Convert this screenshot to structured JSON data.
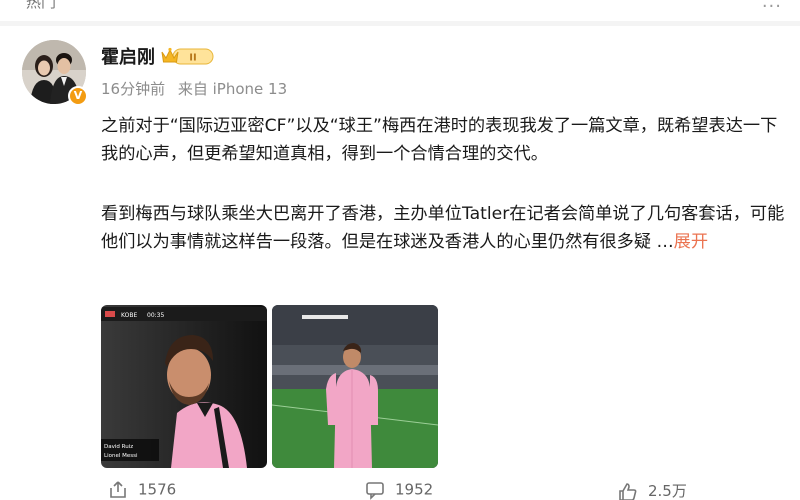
{
  "header": {
    "tab_label": "热门",
    "more_menu": "···"
  },
  "post": {
    "author": {
      "name": "霍启刚",
      "badge_level": "II",
      "verified_mark": "V"
    },
    "meta": {
      "time": "16分钟前",
      "source": "来自 iPhone 13"
    },
    "paragraphs": [
      "之前对于“国际迈亚密CF”以及“球王”梅西在港时的表现我发了一篇文章，既希望表达一下我的心声，但更希望知道真相，得到一个合情合理的交代。",
      "看到梅西与球队乘坐大巴离开了香港，主办单位Tatler在记者会简单说了几句客套话，可能他们以为事情就这样告一段落。但是在球迷及香港人的心里仍然有很多疑 …"
    ],
    "expand_label": "展开",
    "images": [
      {
        "overlay_team": "KOBE",
        "overlay_score": "00:35",
        "caption_line1": "David Ruiz",
        "caption_line2": "Lionel Messi"
      },
      {}
    ],
    "actions": {
      "share_count": "1576",
      "comment_count": "1952",
      "like_count": "2.5万"
    }
  },
  "colors": {
    "accent": "#eb7350",
    "meta_text": "#8c8c8c",
    "jersey_pink": "#f2a6c6"
  }
}
